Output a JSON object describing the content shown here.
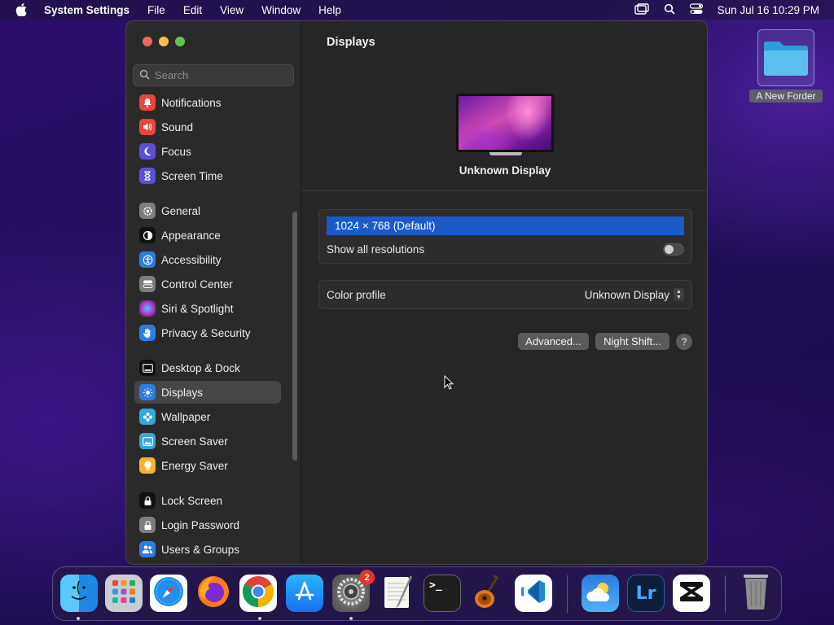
{
  "menubar": {
    "app_name": "System Settings",
    "menus": [
      "File",
      "Edit",
      "View",
      "Window",
      "Help"
    ],
    "datetime": "Sun Jul 16  10:29 PM"
  },
  "sidebar": {
    "search_placeholder": "Search",
    "items": [
      {
        "label": "Notifications",
        "icon": "bell-icon",
        "color": "#e8453c"
      },
      {
        "label": "Sound",
        "icon": "speaker-icon",
        "color": "#e8453c"
      },
      {
        "label": "Focus",
        "icon": "moon-icon",
        "color": "#5b4fd6"
      },
      {
        "label": "Screen Time",
        "icon": "hourglass-icon",
        "color": "#5b4fd6"
      },
      {
        "label": "General",
        "icon": "gear-icon",
        "color": "#7d7d7d"
      },
      {
        "label": "Appearance",
        "icon": "appearance-icon",
        "color": "#111111"
      },
      {
        "label": "Accessibility",
        "icon": "accessibility-icon",
        "color": "#2f7ce0"
      },
      {
        "label": "Control Center",
        "icon": "control-center-icon",
        "color": "#7d7d7d"
      },
      {
        "label": "Siri & Spotlight",
        "icon": "siri-icon",
        "color": "#7a3cd1"
      },
      {
        "label": "Privacy & Security",
        "icon": "hand-icon",
        "color": "#2f7ce0"
      },
      {
        "label": "Desktop & Dock",
        "icon": "dock-icon",
        "color": "#111111"
      },
      {
        "label": "Displays",
        "icon": "sun-icon",
        "color": "#2f7ce0"
      },
      {
        "label": "Wallpaper",
        "icon": "flower-icon",
        "color": "#35a7d8"
      },
      {
        "label": "Screen Saver",
        "icon": "screensaver-icon",
        "color": "#35a7d8"
      },
      {
        "label": "Energy Saver",
        "icon": "bulb-icon",
        "color": "#f2b533"
      },
      {
        "label": "Lock Screen",
        "icon": "lock-icon",
        "color": "#111111"
      },
      {
        "label": "Login Password",
        "icon": "lock-password-icon",
        "color": "#7d7d7d"
      },
      {
        "label": "Users & Groups",
        "icon": "users-icon",
        "color": "#2f7ce0"
      }
    ],
    "selected": "Displays"
  },
  "main": {
    "title": "Displays",
    "display_name": "Unknown Display",
    "resolution": "1024 × 768 (Default)",
    "show_all_label": "Show all resolutions",
    "show_all_on": false,
    "color_profile_label": "Color profile",
    "color_profile_value": "Unknown Display",
    "advanced_button": "Advanced...",
    "night_shift_button": "Night Shift...",
    "help_button": "?"
  },
  "desktop": {
    "folder_label": "A New Forder"
  },
  "dock": {
    "items": [
      {
        "name": "Finder",
        "icon": "finder-icon",
        "running": true
      },
      {
        "name": "Launchpad",
        "icon": "launchpad-icon",
        "running": false
      },
      {
        "name": "Safari",
        "icon": "safari-icon",
        "running": false
      },
      {
        "name": "Firefox",
        "icon": "firefox-icon",
        "running": false
      },
      {
        "name": "Chrome",
        "icon": "chrome-icon",
        "running": true
      },
      {
        "name": "App Store",
        "icon": "app-store-icon",
        "running": false
      },
      {
        "name": "System Settings",
        "icon": "system-settings-icon",
        "running": true,
        "badge": "2"
      },
      {
        "name": "TextEdit",
        "icon": "textedit-icon",
        "running": false
      },
      {
        "name": "Terminal",
        "icon": "terminal-icon",
        "running": false,
        "glyph": ">_"
      },
      {
        "name": "GarageBand",
        "icon": "garageband-icon",
        "running": false
      },
      {
        "name": "VS Code",
        "icon": "vscode-icon",
        "running": false
      },
      {
        "name": "Weather",
        "icon": "weather-icon",
        "running": false
      },
      {
        "name": "Lightroom",
        "icon": "lightroom-icon",
        "running": false,
        "glyph": "Lr"
      },
      {
        "name": "CapCut",
        "icon": "capcut-icon",
        "running": false
      },
      {
        "name": "Trash",
        "icon": "trash-icon",
        "running": false
      }
    ]
  }
}
